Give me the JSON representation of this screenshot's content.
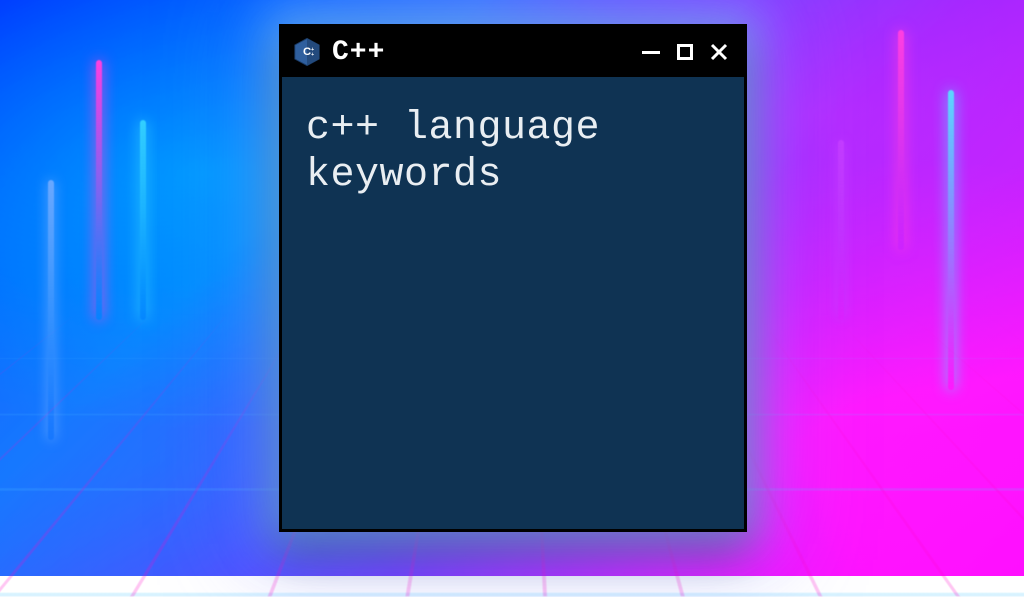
{
  "window": {
    "title": "C++",
    "controls": {
      "minimize": "minimize",
      "maximize": "maximize",
      "close": "close"
    }
  },
  "content": {
    "text": "c++ language\nkeywords"
  },
  "colors": {
    "window_bg": "#0f3353",
    "titlebar_bg": "#000000",
    "text": "#e9eef2",
    "neon_cyan": "#33d0ff",
    "neon_magenta": "#ff3fe0"
  },
  "icon": {
    "name": "cpp-logo"
  }
}
